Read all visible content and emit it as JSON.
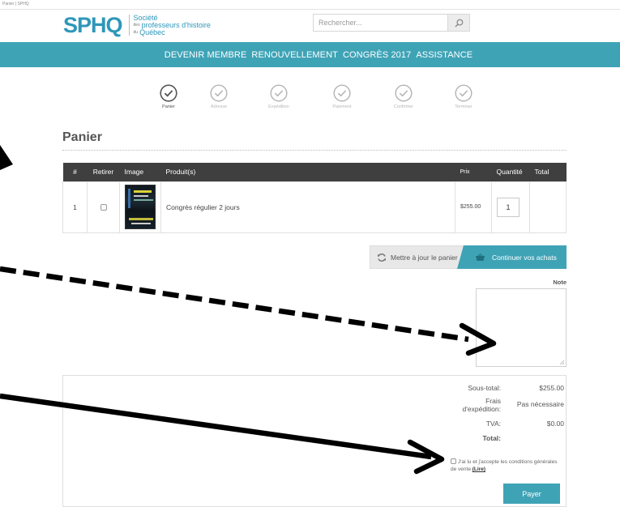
{
  "browser": {
    "tiny_text": "Panier | SPHQ"
  },
  "brand": {
    "logo_mark": "SPHQ",
    "name_line1": "Société",
    "name_line2_prefix": "des",
    "name_line2": "professeurs d'histoire",
    "name_line3_prefix": "du",
    "name_line3": "Québec",
    "accent_color": "#2e97b9",
    "nav_color": "#3fa3b6"
  },
  "search": {
    "placeholder": "Rechercher...",
    "icon": "search-icon"
  },
  "nav": {
    "items": [
      {
        "label": "DEVENIR MEMBRE"
      },
      {
        "label": "RENOUVELLEMENT"
      },
      {
        "label": "CONGRÈS 2017"
      },
      {
        "label": "ASSISTANCE"
      }
    ]
  },
  "checkout_steps": [
    {
      "label": "Panier",
      "active": true
    },
    {
      "label": "Adresse",
      "active": false
    },
    {
      "label": "Expédition",
      "active": false
    },
    {
      "label": "Paiement",
      "active": false
    },
    {
      "label": "Confirmer",
      "active": false
    },
    {
      "label": "Terminer",
      "active": false
    }
  ],
  "page": {
    "title": "Panier"
  },
  "cart": {
    "columns": [
      "#",
      "Retirer",
      "Image",
      "Produit(s)",
      "Prix",
      "Quantité",
      "Total"
    ],
    "rows": [
      {
        "num": "1",
        "remove_checked": false,
        "product": "Congrès régulier 2 jours",
        "price": "$255.00",
        "quantity": "1",
        "total": ""
      }
    ]
  },
  "actions": {
    "update_label": "Mettre à jour le panier",
    "continue_label": "Continuer vos achats"
  },
  "note": {
    "label": "Note",
    "value": ""
  },
  "totals": {
    "subtotal_label": "Sous-total:",
    "subtotal_value": "$255.00",
    "shipping_label_1": "Frais",
    "shipping_label_2": "d'expédition:",
    "shipping_value": "Pas nécessaire",
    "tva_label": "TVA:",
    "tva_value": "$0.00",
    "total_label": "Total:",
    "total_value": ""
  },
  "terms": {
    "text": "J'ai lu et j'accepte les conditions générales de vente",
    "link_label": "(Lire)",
    "checked": false
  },
  "pay": {
    "label": "Payer"
  }
}
